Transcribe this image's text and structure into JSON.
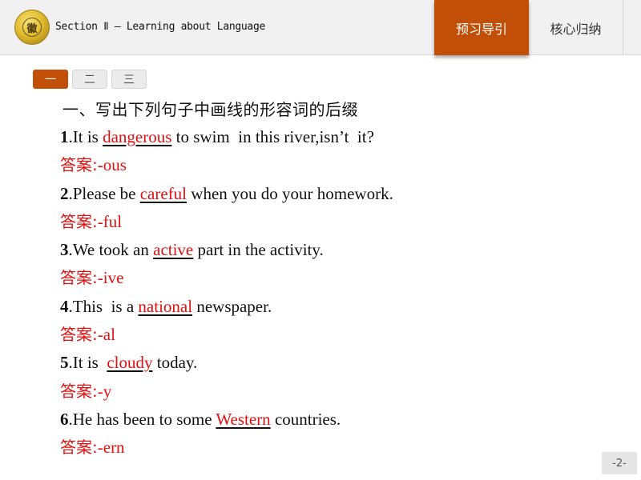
{
  "header": {
    "title": "Section Ⅱ — Learning about Language",
    "logo_icon": "school-emblem-icon",
    "logo_glyph": "徽",
    "tabs": [
      {
        "label": "预习导引",
        "active": true
      },
      {
        "label": "核心归纳",
        "active": false
      }
    ]
  },
  "number_tabs": [
    {
      "label": "一",
      "active": true
    },
    {
      "label": "二",
      "active": false
    },
    {
      "label": "三",
      "active": false
    }
  ],
  "section_heading": "一、写出下列句子中画线的形容词的后缀",
  "answer_label": "答案:",
  "questions": [
    {
      "num": "1",
      "before": ".It is ",
      "keyword": "dangerous",
      "after": " to swim  in this river,isn’t  it?",
      "answer": "-ous"
    },
    {
      "num": "2",
      "before": ".Please be ",
      "keyword": "careful",
      "after": " when you do your homework.",
      "answer": "-ful"
    },
    {
      "num": "3",
      "before": ".We took an ",
      "keyword": "active",
      "after": " part in the activity.",
      "answer": "-ive"
    },
    {
      "num": "4",
      "before": ".This  is a ",
      "keyword": "national",
      "after": " newspaper.",
      "answer": "-al"
    },
    {
      "num": "5",
      "before": ".It is  ",
      "keyword": "cloudy",
      "after": " today.",
      "answer": "-y"
    },
    {
      "num": "6",
      "before": ".He has been to some ",
      "keyword": "Western",
      "after": " countries.",
      "answer": "-ern"
    }
  ],
  "page_number": "-2-",
  "colors": {
    "accent": "#c24f07",
    "answer_red": "#e01010"
  }
}
